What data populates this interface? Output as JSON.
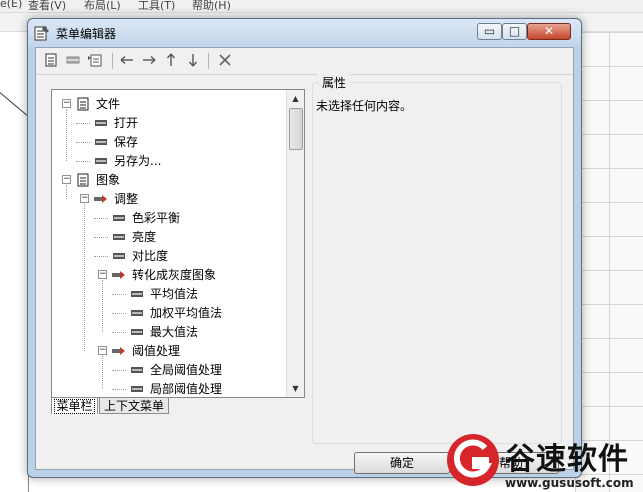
{
  "background_app": {
    "menu": [
      "e(E)",
      "查看(V)",
      "布局(L)",
      "工具(T)",
      "帮助(H)"
    ]
  },
  "dialog": {
    "title": "菜单编辑器",
    "controls": {
      "minimize": "▭",
      "maximize": "□",
      "close": "✕"
    }
  },
  "toolbar": {
    "buttons": [
      "new-menu-icon",
      "new-item-icon",
      "new-submenu-icon",
      "arrow-left-icon",
      "arrow-right-icon",
      "arrow-up-icon",
      "arrow-down-icon",
      "delete-icon"
    ]
  },
  "tree": {
    "items": [
      {
        "label": "文件",
        "level": 0,
        "kind": "menu",
        "expanded": true
      },
      {
        "label": "打开",
        "level": 1,
        "kind": "item"
      },
      {
        "label": "保存",
        "level": 1,
        "kind": "item"
      },
      {
        "label": "另存为...",
        "level": 1,
        "kind": "item"
      },
      {
        "label": "图象",
        "level": 0,
        "kind": "menu",
        "expanded": true
      },
      {
        "label": "调整",
        "level": 1,
        "kind": "submenu",
        "expanded": true
      },
      {
        "label": "色彩平衡",
        "level": 2,
        "kind": "item"
      },
      {
        "label": "亮度",
        "level": 2,
        "kind": "item"
      },
      {
        "label": "对比度",
        "level": 2,
        "kind": "item"
      },
      {
        "label": "转化成灰度图象",
        "level": 2,
        "kind": "submenu",
        "expanded": true
      },
      {
        "label": "平均值法",
        "level": 3,
        "kind": "item"
      },
      {
        "label": "加权平均值法",
        "level": 3,
        "kind": "item"
      },
      {
        "label": "最大值法",
        "level": 3,
        "kind": "item"
      },
      {
        "label": "阈值处理",
        "level": 2,
        "kind": "submenu",
        "expanded": true
      },
      {
        "label": "全局阈值处理",
        "level": 3,
        "kind": "item"
      },
      {
        "label": "局部阈值处理",
        "level": 3,
        "kind": "item"
      }
    ]
  },
  "tabs": [
    {
      "label": "菜单栏",
      "active": true
    },
    {
      "label": "上下文菜单",
      "active": false
    }
  ],
  "properties": {
    "title": "属性",
    "value": "未选择任何内容。"
  },
  "buttons": {
    "ok": "确定",
    "help": "帮助"
  },
  "watermark": {
    "brand": "谷速软件",
    "url": "www.gususoft.com"
  },
  "colors": {
    "accent_red": "#d7262b",
    "title_bar": "#c9d9ec"
  }
}
